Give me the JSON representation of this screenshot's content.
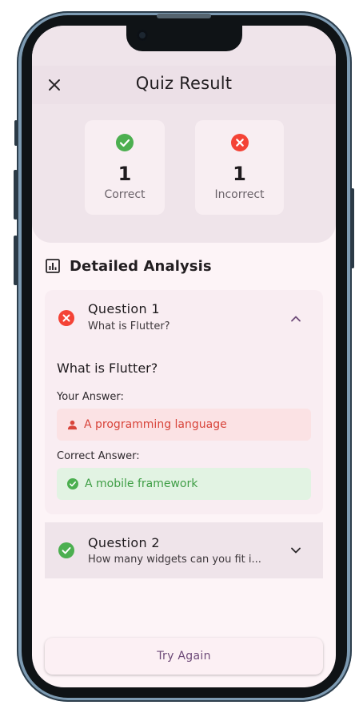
{
  "app": {
    "title": "Quiz Result",
    "close_icon": "close-icon"
  },
  "summary": {
    "correct": {
      "count": "1",
      "label": "Correct",
      "icon": "check-circle-icon",
      "color": "#4caf50"
    },
    "incorrect": {
      "count": "1",
      "label": "Incorrect",
      "icon": "cancel-circle-icon",
      "color": "#f44336"
    }
  },
  "analysis": {
    "title": "Detailed Analysis",
    "icon": "analytics-icon",
    "questions": [
      {
        "title": "Question 1",
        "subtitle": "What is Flutter?",
        "status": "incorrect",
        "expanded": true,
        "question_text": "What is Flutter?",
        "your_answer_label": "Your Answer:",
        "your_answer": "A programming language",
        "correct_answer_label": "Correct Answer:",
        "correct_answer": "A mobile framework"
      },
      {
        "title": "Question 2",
        "subtitle": "How many widgets can you fit i...",
        "status": "correct",
        "expanded": false
      }
    ]
  },
  "footer": {
    "try_again_label": "Try Again"
  },
  "colors": {
    "accent": "#6d4a78",
    "correct": "#4caf50",
    "incorrect": "#f44336",
    "background": "#fdf4f7"
  }
}
